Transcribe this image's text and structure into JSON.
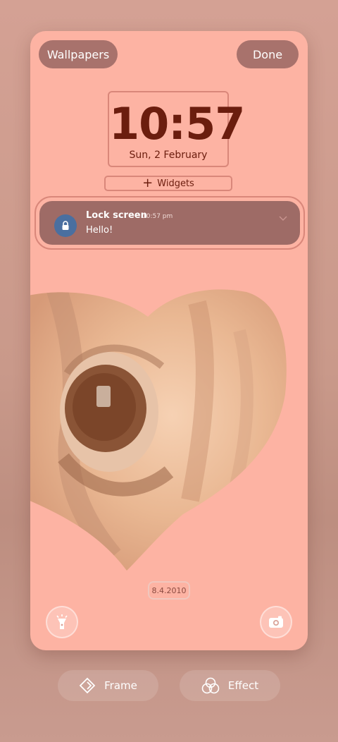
{
  "header": {
    "wallpapers_label": "Wallpapers",
    "done_label": "Done"
  },
  "clock": {
    "time": "10:57",
    "date": "Sun, 2 February"
  },
  "widgets": {
    "label": "Widgets"
  },
  "notification": {
    "title": "Lock screen",
    "time": "10:57 pm",
    "body": "Hello!"
  },
  "photo": {
    "date_stamp": "8.4.2010"
  },
  "shortcuts": {
    "left": "flashlight-icon",
    "right": "camera-icon"
  },
  "bottom_bar": {
    "frame_label": "Frame",
    "effect_label": "Effect"
  },
  "colors": {
    "preview_bg": "#fdb3a3",
    "clock_text": "#6b1d0e",
    "pill_bg": "#a8726c",
    "notification_bg": "#9e6b66"
  }
}
